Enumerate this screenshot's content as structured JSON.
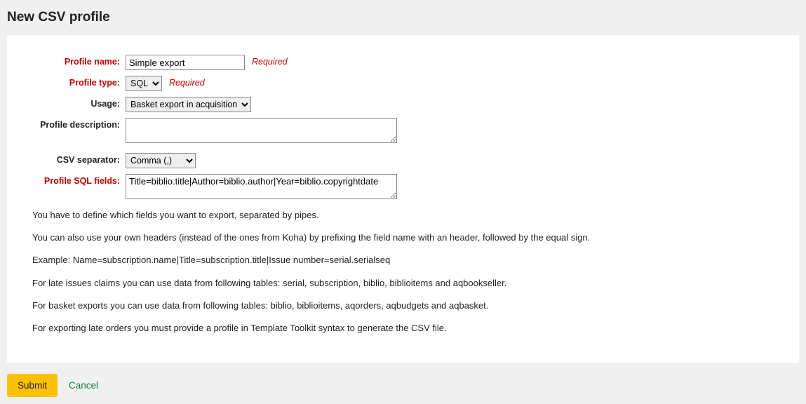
{
  "title": "New CSV profile",
  "labels": {
    "profile_name": "Profile name:",
    "profile_type": "Profile type:",
    "usage": "Usage:",
    "profile_description": "Profile description:",
    "csv_separator": "CSV separator:",
    "profile_sql_fields": "Profile SQL fields:"
  },
  "values": {
    "profile_name": "Simple export",
    "profile_type": "SQL",
    "usage": "Basket export in acquisition",
    "profile_description": "",
    "csv_separator": "Comma (,)",
    "profile_sql_fields": "Title=biblio.title|Author=biblio.author|Year=biblio.copyrightdate"
  },
  "required_text": "Required",
  "info": [
    "You have to define which fields you want to export, separated by pipes.",
    "You can also use your own headers (instead of the ones from Koha) by prefixing the field name with an header, followed by the equal sign.",
    "Example: Name=subscription.name|Title=subscription.title|Issue number=serial.serialseq",
    "For late issues claims you can use data from following tables: serial, subscription, biblio, biblioitems and aqbookseller.",
    "For basket exports you can use data from following tables: biblio, biblioitems, aqorders, aqbudgets and aqbasket.",
    "For exporting late orders you must provide a profile in Template Toolkit syntax to generate the CSV file."
  ],
  "actions": {
    "submit": "Submit",
    "cancel": "Cancel"
  }
}
